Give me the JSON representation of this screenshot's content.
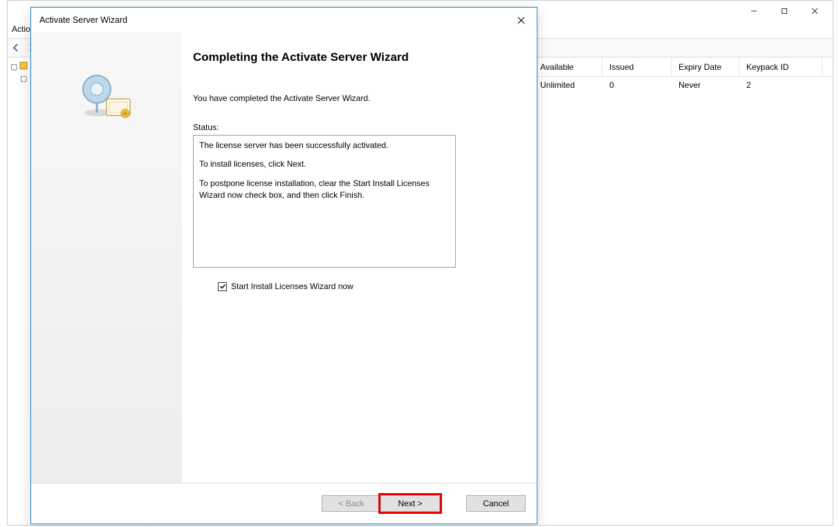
{
  "main_window": {
    "menubar_fragment": "Actio",
    "toolbar_items": [
      "nav-back-icon",
      "nav-fwd-icon",
      "nav-sep-icon"
    ],
    "columns": {
      "available": "Available",
      "issued": "Issued",
      "expiry": "Expiry Date",
      "keypack": "Keypack ID"
    },
    "row": {
      "available": "Unlimited",
      "issued": "0",
      "expiry": "Never",
      "keypack": "2"
    }
  },
  "wizard": {
    "title": "Activate Server Wizard",
    "heading": "Completing the Activate Server Wizard",
    "subtext": "You have completed the Activate Server Wizard.",
    "status_label": "Status:",
    "status_lines": {
      "l1": "The license server has been successfully activated.",
      "l2": "To install licenses, click Next.",
      "l3": "To postpone license installation, clear the Start Install Licenses Wizard now check box, and then click Finish."
    },
    "checkbox_label": "Start Install Licenses Wizard now",
    "checkbox_checked": true,
    "buttons": {
      "back": "< Back",
      "next": "Next >",
      "cancel": "Cancel"
    }
  }
}
